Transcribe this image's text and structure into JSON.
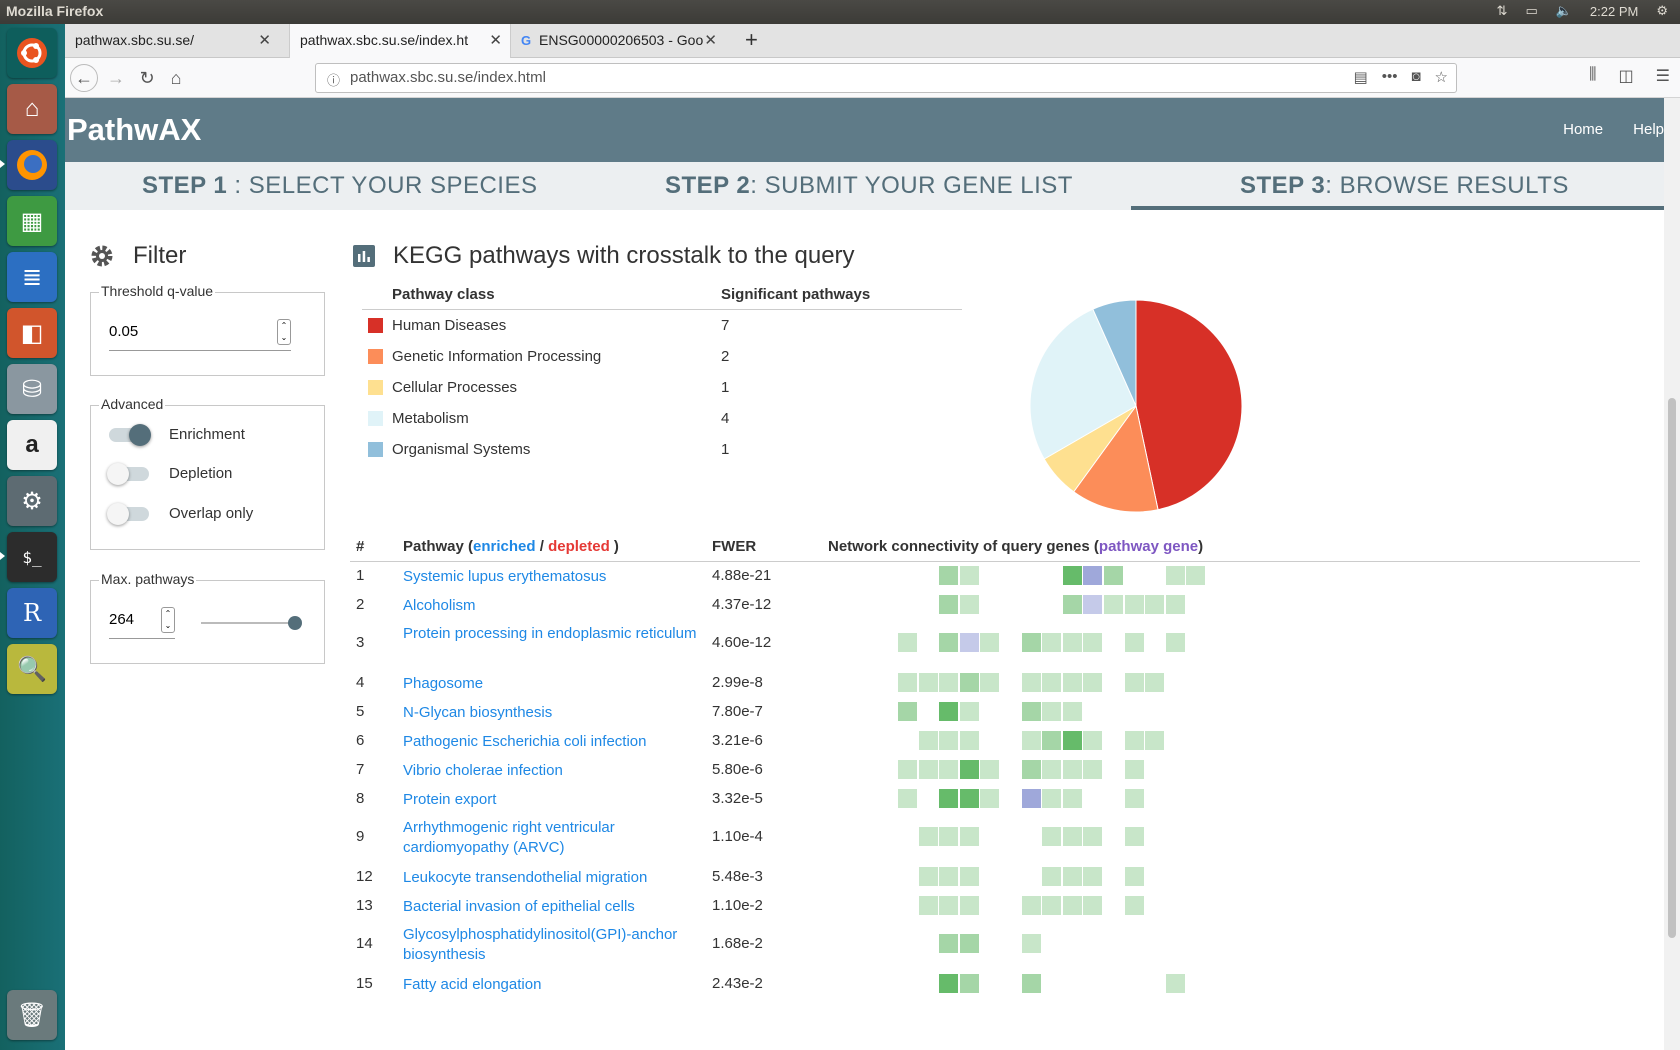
{
  "os": {
    "window_title": "Mozilla Firefox",
    "clock": "2:22 PM"
  },
  "browser": {
    "tabs": [
      {
        "label": "pathwax.sbc.su.se/",
        "active": false,
        "icon": ""
      },
      {
        "label": "pathwax.sbc.su.se/index.ht",
        "active": true,
        "icon": ""
      },
      {
        "label": "ENSG00000206503 - Goo",
        "active": false,
        "icon": "google-icon"
      }
    ],
    "url": "pathwax.sbc.su.se/index.html"
  },
  "app": {
    "title": "PathwAX",
    "nav": [
      "Home",
      "Help"
    ],
    "steps": [
      {
        "bold": "STEP 1",
        "rest": " : SELECT YOUR SPECIES"
      },
      {
        "bold": "STEP 2",
        "rest": ": SUBMIT YOUR GENE LIST"
      },
      {
        "bold": "STEP 3",
        "rest": ": BROWSE RESULTS"
      }
    ]
  },
  "filter": {
    "heading": "Filter",
    "threshold_legend": "Threshold q-value",
    "threshold_value": "0.05",
    "advanced_legend": "Advanced",
    "toggles": [
      {
        "label": "Enrichment",
        "on": true
      },
      {
        "label": "Depletion",
        "on": false
      },
      {
        "label": "Overlap only",
        "on": false
      }
    ],
    "max_legend": "Max. pathways",
    "max_value": "264",
    "max_slider_fraction": 1.0
  },
  "main": {
    "heading": "KEGG pathways with crosstalk to the query",
    "class_table": {
      "col_class": "Pathway class",
      "col_count": "Significant pathways",
      "rows": [
        {
          "name": "Human Diseases",
          "count": "7",
          "color": "#d73027"
        },
        {
          "name": "Genetic Information Processing",
          "count": "2",
          "color": "#fc8d59"
        },
        {
          "name": "Cellular Processes",
          "count": "1",
          "color": "#fee090"
        },
        {
          "name": "Metabolism",
          "count": "4",
          "color": "#e0f3f8"
        },
        {
          "name": "Organismal Systems",
          "count": "1",
          "color": "#91bfdb"
        }
      ]
    },
    "pathway_table": {
      "col_num": "#",
      "col_pathway_prefix": "Pathway (",
      "col_enriched": "enriched",
      "col_slash": " / ",
      "col_depleted": "depleted",
      "col_pathway_suffix": " )",
      "col_fwer": "FWER",
      "col_network_prefix": "Network connectivity of query genes (",
      "col_pathway_gene": "pathway gene",
      "col_network_suffix": ")",
      "colors": {
        "enriched": "#1e88e5",
        "depleted": "#e53935",
        "pathway_gene": "#7e57c2",
        "light": "#c8e6c9",
        "mid": "#a5d6a7",
        "dark": "#66bb6a",
        "purple": "#9fa8da",
        "lpurple": "#c5cae9"
      },
      "rows": [
        {
          "num": "1",
          "name": "Systemic lupus erythematosus",
          "fwer": "4.88e-21",
          "cells": "..mL....DPm..LL...."
        },
        {
          "num": "2",
          "name": "Alcoholism",
          "fwer": "4.37e-12",
          "cells": "..mL....mQLLLL....."
        },
        {
          "num": "3",
          "name": "Protein processing in endoplasmic reticulum",
          "fwer": "4.60e-12",
          "cells": "L.mQL.mLLL.L.L....."
        },
        {
          "num": "4",
          "name": "Phagosome",
          "fwer": "2.99e-8",
          "cells": "LLLmL.LLLL.LL......"
        },
        {
          "num": "5",
          "name": "N-Glycan biosynthesis",
          "fwer": "7.80e-7",
          "cells": "m.DL..mLL.........."
        },
        {
          "num": "6",
          "name": "Pathogenic Escherichia coli infection",
          "fwer": "3.21e-6",
          "cells": ".LLL..LmDL.LL......"
        },
        {
          "num": "7",
          "name": "Vibrio cholerae infection",
          "fwer": "5.80e-6",
          "cells": "LLLDL.mLLL.L......."
        },
        {
          "num": "8",
          "name": "Protein export",
          "fwer": "3.32e-5",
          "cells": "L.DDL.PLL..L......."
        },
        {
          "num": "9",
          "name": "Arrhythmogenic right ventricular cardiomyopathy (ARVC)",
          "fwer": "1.10e-4",
          "cells": ".LLL...LLL.L......."
        },
        {
          "num": "12",
          "name": "Leukocyte transendothelial migration",
          "fwer": "5.48e-3",
          "cells": ".LLL...LLL.L......."
        },
        {
          "num": "13",
          "name": "Bacterial invasion of epithelial cells",
          "fwer": "1.10e-2",
          "cells": ".LLL..LLLL.L......."
        },
        {
          "num": "14",
          "name": "Glycosylphosphatidylinositol(GPI)-anchor biosynthesis",
          "fwer": "1.68e-2",
          "cells": "..mm..L............"
        },
        {
          "num": "15",
          "name": "Fatty acid elongation",
          "fwer": "2.43e-2",
          "cells": "..Dm..m......L....."
        }
      ]
    }
  },
  "chart_data": {
    "type": "pie",
    "categories": [
      "Human Diseases",
      "Genetic Information Processing",
      "Cellular Processes",
      "Metabolism",
      "Organismal Systems"
    ],
    "values": [
      7,
      2,
      1,
      4,
      1
    ],
    "colors": [
      "#d73027",
      "#fc8d59",
      "#fee090",
      "#e0f3f8",
      "#91bfdb"
    ],
    "title": ""
  }
}
